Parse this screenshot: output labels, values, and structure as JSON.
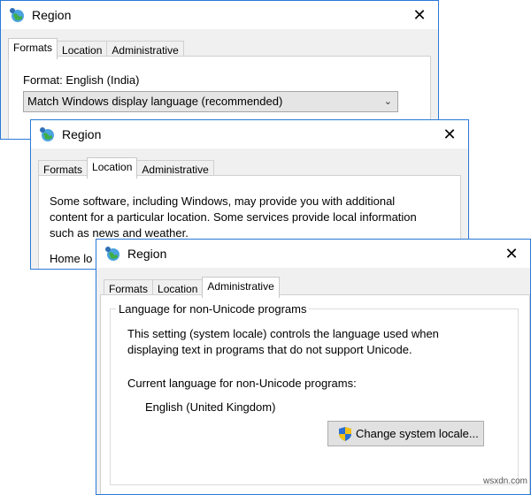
{
  "window1": {
    "title": "Region",
    "tabs": [
      "Formats",
      "Location",
      "Administrative"
    ],
    "active_tab": "Formats",
    "format_label": "Format: English (India)",
    "format_select": "Match Windows display language (recommended)"
  },
  "window2": {
    "title": "Region",
    "tabs": [
      "Formats",
      "Location",
      "Administrative"
    ],
    "active_tab": "Location",
    "desc_lines": [
      "Some software, including Windows, may provide you with additional",
      "content for a particular location. Some services provide local information",
      "such as news and weather."
    ],
    "home_label": "Home lo"
  },
  "window3": {
    "title": "Region",
    "tabs": [
      "Formats",
      "Location",
      "Administrative"
    ],
    "active_tab": "Administrative",
    "group_title": "Language for non-Unicode programs",
    "desc_lines": [
      "This setting (system locale) controls the language used when",
      "displaying text in programs that do not support Unicode."
    ],
    "current_label": "Current language for non-Unicode programs:",
    "current_value": "English (United Kingdom)",
    "change_button": "Change system locale..."
  },
  "close_glyph": "✕",
  "chevron_glyph": "⌄",
  "watermark": "wsxdn.com",
  "colors": {
    "window_border": "#2b79d8",
    "shield_blue": "#2a6fd6",
    "shield_yellow": "#f2c21b"
  },
  "icons": [
    "globe-icon",
    "close-icon",
    "chevron-down-icon",
    "uac-shield-icon"
  ]
}
